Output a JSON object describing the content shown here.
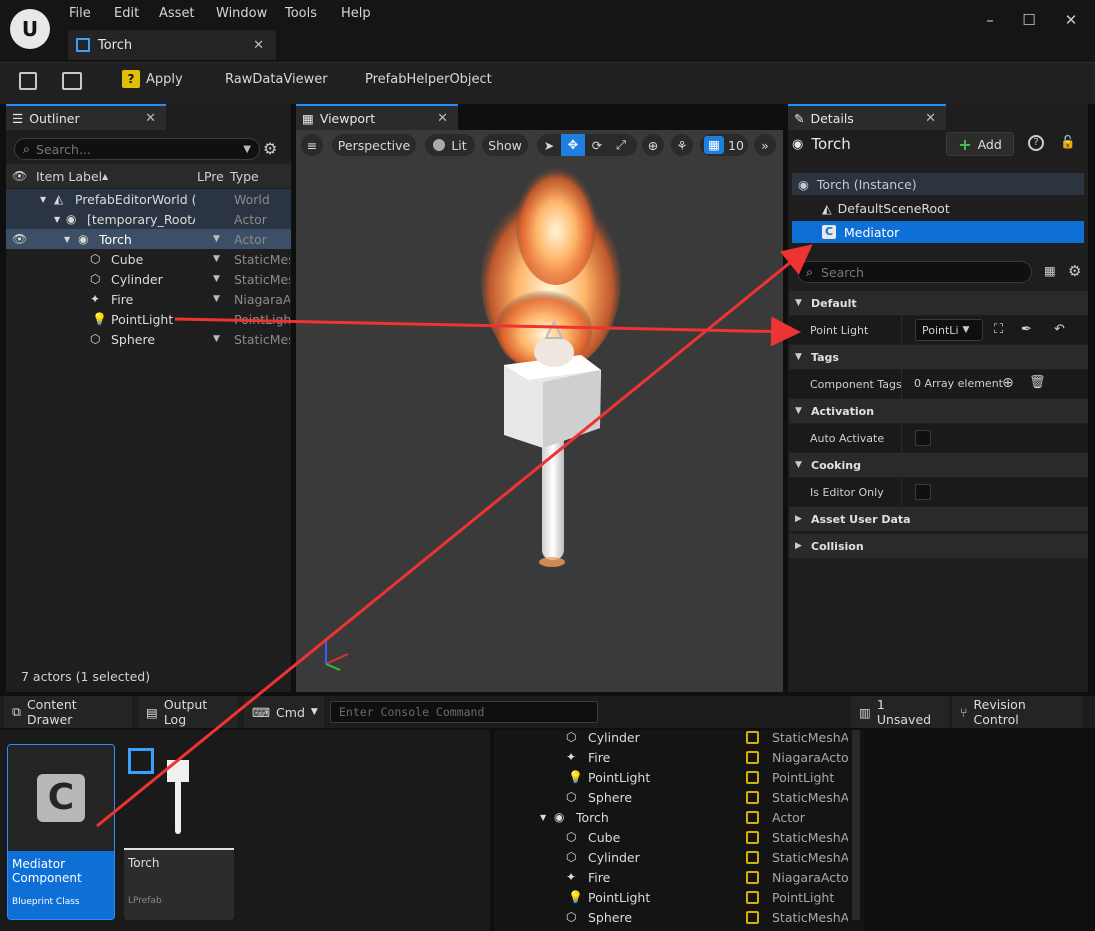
{
  "menu": [
    "File",
    "Edit",
    "Asset",
    "Window",
    "Tools",
    "Help"
  ],
  "document_tab": "Torch",
  "toolbar": {
    "apply": "Apply",
    "raw": "RawDataViewer",
    "helper": "PrefabHelperObject"
  },
  "outliner": {
    "tab": "Outliner",
    "search_placeholder": "Search...",
    "columns": {
      "label": "Item Label",
      "lpre": "LPre",
      "type": "Type"
    },
    "rows": [
      {
        "label": "PrefabEditorWorld (E",
        "type": "World"
      },
      {
        "label": "[temporary_RootA",
        "type": "Actor"
      },
      {
        "label": "Torch",
        "type": "Actor"
      },
      {
        "label": "Cube",
        "type": "StaticMes"
      },
      {
        "label": "Cylinder",
        "type": "StaticMes"
      },
      {
        "label": "Fire",
        "type": "NiagaraAc"
      },
      {
        "label": "PointLight",
        "type": "PointLight"
      },
      {
        "label": "Sphere",
        "type": "StaticMes"
      }
    ],
    "status": "7 actors (1 selected)"
  },
  "viewport": {
    "tab": "Viewport",
    "perspective": "Perspective",
    "lit": "Lit",
    "show": "Show",
    "grid_size": "10"
  },
  "details": {
    "tab": "Details",
    "actor": "Torch",
    "add": "Add",
    "instance": "Torch (Instance)",
    "components": [
      "DefaultSceneRoot",
      "Mediator"
    ],
    "search_placeholder": "Search",
    "sections": {
      "default": "Default",
      "tags": "Tags",
      "activation": "Activation",
      "cooking": "Cooking",
      "asset_user_data": "Asset User Data",
      "collision": "Collision"
    },
    "props": {
      "point_light": "Point Light",
      "point_light_value": "PointLi",
      "component_tags": "Component Tags",
      "component_tags_value": "0 Array element",
      "auto_activate": "Auto Activate",
      "editor_only": "Is Editor Only"
    }
  },
  "bottombar": {
    "content_drawer": "Content Drawer",
    "output_log": "Output Log",
    "cmd": "Cmd",
    "console_placeholder": "Enter Console Command",
    "unsaved": "1 Unsaved",
    "revision": "Revision Control"
  },
  "assets": [
    {
      "name": "Mediator Component",
      "kind": "Blueprint Class"
    },
    {
      "name": "Torch",
      "kind": "LPrefab"
    }
  ],
  "background_list": [
    {
      "label": "Cylinder",
      "type": "StaticMeshA"
    },
    {
      "label": "Fire",
      "type": "NiagaraActor"
    },
    {
      "label": "PointLight",
      "type": "PointLight"
    },
    {
      "label": "Sphere",
      "type": "StaticMeshA"
    },
    {
      "label": "Torch",
      "type": "Actor"
    },
    {
      "label": "Cube",
      "type": "StaticMeshA"
    },
    {
      "label": "Cylinder",
      "type": "StaticMeshA"
    },
    {
      "label": "Fire",
      "type": "NiagaraActor"
    },
    {
      "label": "PointLight",
      "type": "PointLight"
    },
    {
      "label": "Sphere",
      "type": "StaticMeshA"
    }
  ],
  "colors": {
    "accent": "#1e90ff",
    "selection": "#0e6fd6",
    "annotation": "#ee3333"
  }
}
